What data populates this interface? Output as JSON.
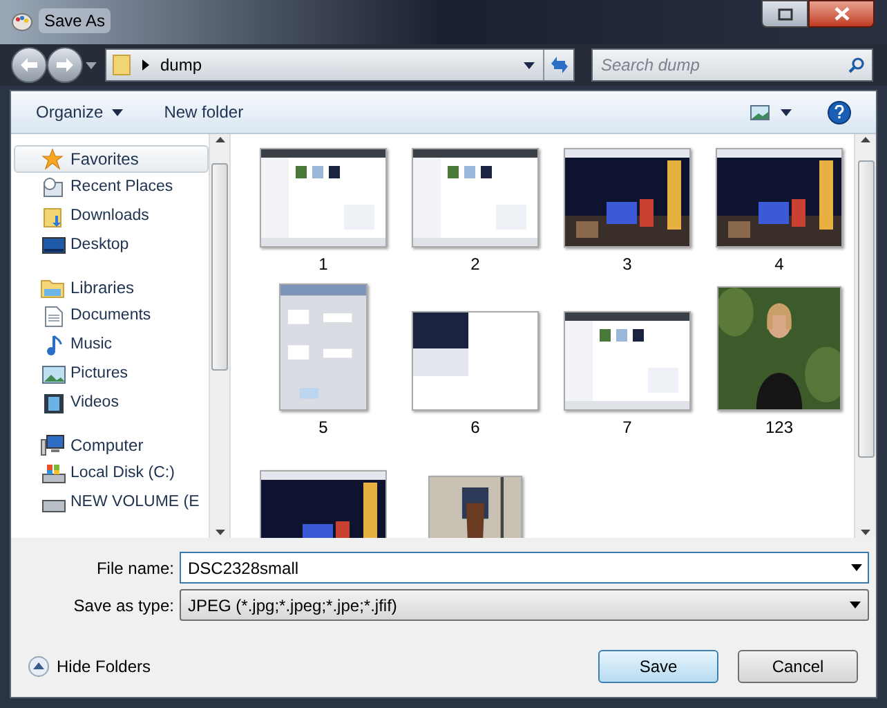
{
  "window": {
    "title": "Save As"
  },
  "address": {
    "crumbs": [
      "dump"
    ]
  },
  "search": {
    "placeholder": "Search dump"
  },
  "toolbar": {
    "organize": "Organize",
    "new_folder": "New folder"
  },
  "sidebar": {
    "groups": [
      {
        "label": "Favorites",
        "selected": true,
        "children": [
          {
            "label": "Recent Places"
          },
          {
            "label": "Downloads"
          },
          {
            "label": "Desktop"
          }
        ]
      },
      {
        "label": "Libraries",
        "selected": false,
        "children": [
          {
            "label": "Documents"
          },
          {
            "label": "Music"
          },
          {
            "label": "Pictures"
          },
          {
            "label": "Videos"
          }
        ]
      },
      {
        "label": "Computer",
        "selected": false,
        "children": [
          {
            "label": "Local Disk (C:)"
          },
          {
            "label": "NEW VOLUME (E"
          }
        ]
      }
    ]
  },
  "files": [
    {
      "name": "1",
      "kind": "picture"
    },
    {
      "name": "2",
      "kind": "picture"
    },
    {
      "name": "3",
      "kind": "picture"
    },
    {
      "name": "4",
      "kind": "picture"
    },
    {
      "name": "5",
      "kind": "picture"
    },
    {
      "name": "6",
      "kind": "picture"
    },
    {
      "name": "7",
      "kind": "picture"
    },
    {
      "name": "123",
      "kind": "picture"
    },
    {
      "kind": "picture"
    },
    {
      "kind": "picture"
    }
  ],
  "form": {
    "file_name_label": "File name:",
    "file_name": "DSC2328small",
    "type_label": "Save as type:",
    "type": "JPEG (*.jpg;*.jpeg;*.jpe;*.jfif)"
  },
  "hide_folders": "Hide Folders",
  "buttons": [
    {
      "label": "Save",
      "default": true
    },
    {
      "label": "Cancel",
      "default": false
    }
  ]
}
